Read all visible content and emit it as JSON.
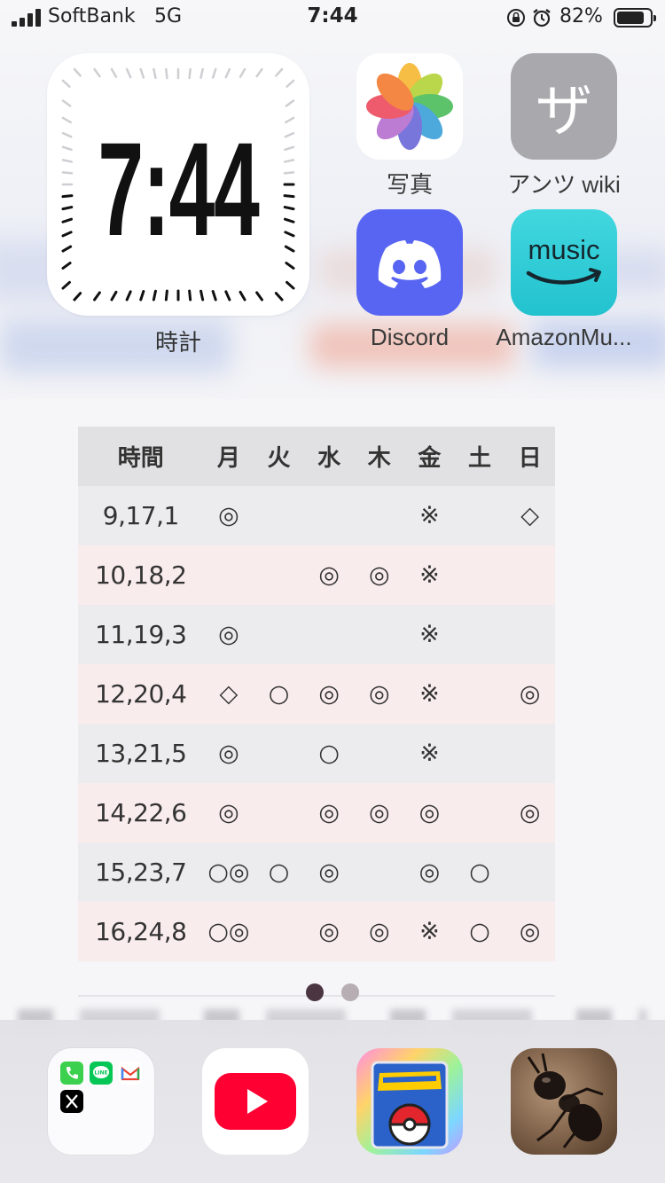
{
  "status_bar": {
    "carrier": "SoftBank",
    "network": "5G",
    "time": "7:44",
    "battery_percent": "82%",
    "battery_level": 0.82
  },
  "clock_widget": {
    "time": "7:44",
    "label": "時計"
  },
  "apps": {
    "photos": {
      "label": "写真"
    },
    "zu_wiki": {
      "label": "アンツ wiki",
      "glyph": "ザ"
    },
    "discord": {
      "label": "Discord"
    },
    "amazon_music": {
      "label": "AmazonMu...",
      "word": "music"
    }
  },
  "timetable": {
    "headers": [
      "時間",
      "月",
      "火",
      "水",
      "木",
      "金",
      "土",
      "日"
    ],
    "rows": [
      [
        "9,17,1",
        "◎",
        "",
        "",
        "",
        "※",
        "",
        "◇"
      ],
      [
        "10,18,2",
        "",
        "",
        "◎",
        "◎",
        "※",
        "",
        ""
      ],
      [
        "11,19,3",
        "◎",
        "",
        "",
        "",
        "※",
        "",
        ""
      ],
      [
        "12,20,4",
        "◇",
        "○",
        "◎",
        "◎",
        "※",
        "",
        "◎"
      ],
      [
        "13,21,5",
        "◎",
        "",
        "○",
        "",
        "※",
        "",
        ""
      ],
      [
        "14,22,6",
        "◎",
        "",
        "◎",
        "◎",
        "◎",
        "",
        "◎"
      ],
      [
        "15,23,7",
        "○◎",
        "○",
        "◎",
        "",
        "◎",
        "○",
        ""
      ],
      [
        "16,24,8",
        "○◎",
        "",
        "◎",
        "◎",
        "※",
        "○",
        "◎"
      ]
    ]
  },
  "page_indicator": {
    "current": 1,
    "total": 2
  },
  "dock": {
    "apps": [
      "folder-phone-line-gmail-x",
      "youtube",
      "pokemon-tcg",
      "ant-game"
    ]
  }
}
